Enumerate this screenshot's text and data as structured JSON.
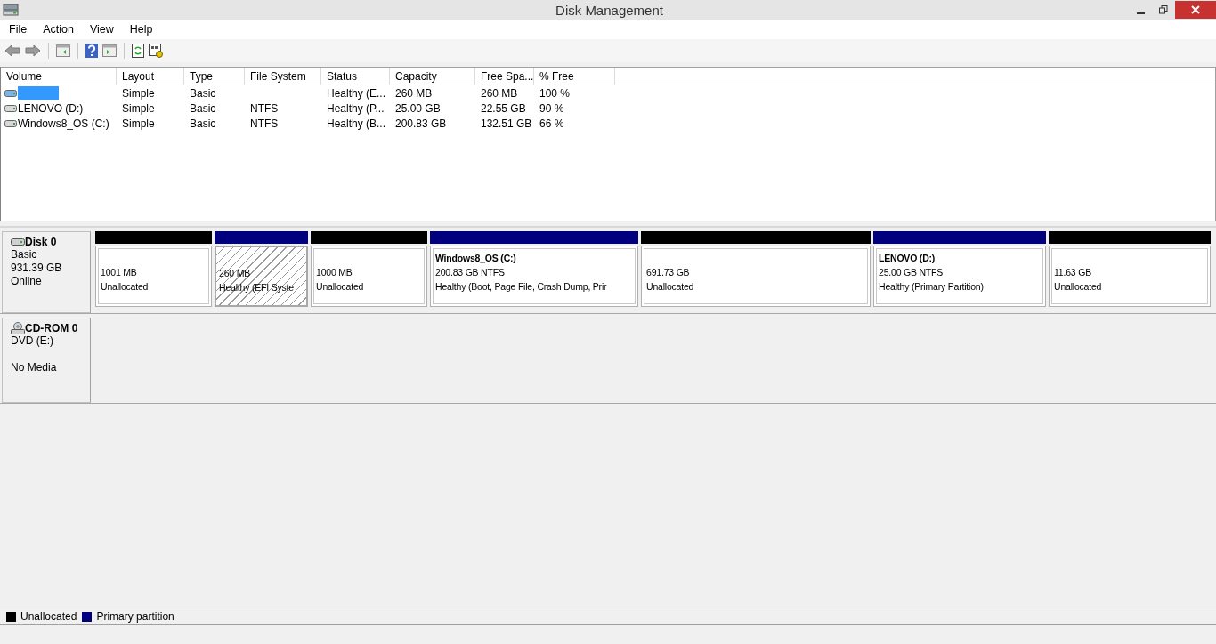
{
  "window": {
    "title": "Disk Management"
  },
  "menu": [
    "File",
    "Action",
    "View",
    "Help"
  ],
  "table": {
    "columns": [
      "Volume",
      "Layout",
      "Type",
      "File System",
      "Status",
      "Capacity",
      "Free Spa...",
      "% Free"
    ],
    "rows": [
      {
        "selected": true,
        "cells": [
          "",
          "Simple",
          "Basic",
          "",
          "Healthy (E...",
          "260 MB",
          "260 MB",
          "100 %"
        ]
      },
      {
        "selected": false,
        "cells": [
          "LENOVO (D:)",
          "Simple",
          "Basic",
          "NTFS",
          "Healthy (P...",
          "25.00 GB",
          "22.55 GB",
          "90 %"
        ]
      },
      {
        "selected": false,
        "cells": [
          "Windows8_OS (C:)",
          "Simple",
          "Basic",
          "NTFS",
          "Healthy (B...",
          "200.83 GB",
          "132.51 GB",
          "66 %"
        ]
      }
    ]
  },
  "disks": [
    {
      "kind": "disk",
      "name": "Disk 0",
      "lines": [
        "Basic",
        "931.39 GB",
        "Online"
      ],
      "partitions": [
        {
          "kind": "unallocated",
          "selected": false,
          "size": "1001 MB",
          "status": "Unallocated"
        },
        {
          "kind": "primary",
          "selected": true,
          "size": "260 MB",
          "status": "Healthy (EFI Syste"
        },
        {
          "kind": "unallocated",
          "selected": false,
          "size": "1000 MB",
          "status": "Unallocated"
        },
        {
          "kind": "primary",
          "selected": false,
          "label": "Windows8_OS  (C:)",
          "size": "200.83 GB NTFS",
          "status": "Healthy (Boot, Page File, Crash Dump, Prir"
        },
        {
          "kind": "unallocated",
          "selected": false,
          "size": "691.73 GB",
          "status": "Unallocated"
        },
        {
          "kind": "primary",
          "selected": false,
          "label": "LENOVO  (D:)",
          "size": "25.00 GB NTFS",
          "status": "Healthy (Primary Partition)"
        },
        {
          "kind": "unallocated",
          "selected": false,
          "size": "11.63 GB",
          "status": "Unallocated"
        }
      ]
    },
    {
      "kind": "cdrom",
      "name": "CD-ROM 0",
      "lines": [
        "DVD (E:)",
        "No Media"
      ]
    }
  ],
  "legend": [
    {
      "label": "Unallocated",
      "color": "#000000"
    },
    {
      "label": "Primary partition",
      "color": "#00007f"
    }
  ]
}
